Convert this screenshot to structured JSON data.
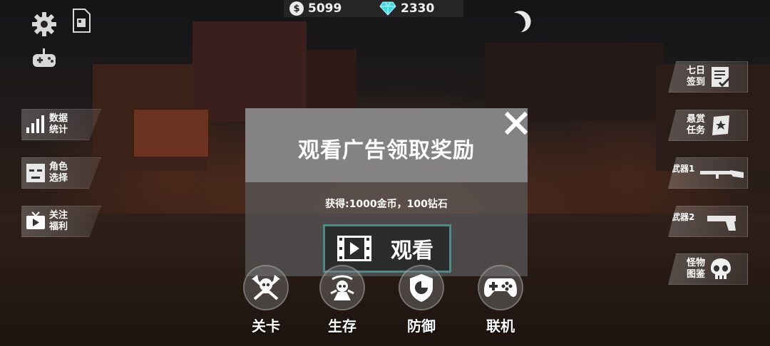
{
  "currency": {
    "coins": "5099",
    "gems": "2330"
  },
  "dialog": {
    "title": "观看广告领取奖励",
    "reward": "获得:1000金币，100钻石",
    "watch_label": "观看"
  },
  "left_menu": [
    {
      "label": "数据统计",
      "icon": "bar-chart-icon"
    },
    {
      "label": "角色选择",
      "icon": "character-face-icon"
    },
    {
      "label": "关注福利",
      "icon": "tv-icon"
    }
  ],
  "right_menu": [
    {
      "label": "七日签到",
      "icon": "checklist-icon"
    },
    {
      "label": "悬赏任务",
      "icon": "bounty-icon"
    },
    {
      "label": "武器1",
      "icon": "rifle-icon"
    },
    {
      "label": "武器2",
      "icon": "pistol-icon"
    },
    {
      "label": "怪物图鉴",
      "icon": "skull-icon"
    }
  ],
  "modes": [
    {
      "label": "关卡",
      "icon": "skull-axes-icon"
    },
    {
      "label": "生存",
      "icon": "survival-icon"
    },
    {
      "label": "防御",
      "icon": "shield-icon"
    },
    {
      "label": "联机",
      "icon": "gamepad-icon"
    }
  ],
  "colors": {
    "watch_border": "#4f8a86",
    "gem": "#3fd8e0"
  }
}
